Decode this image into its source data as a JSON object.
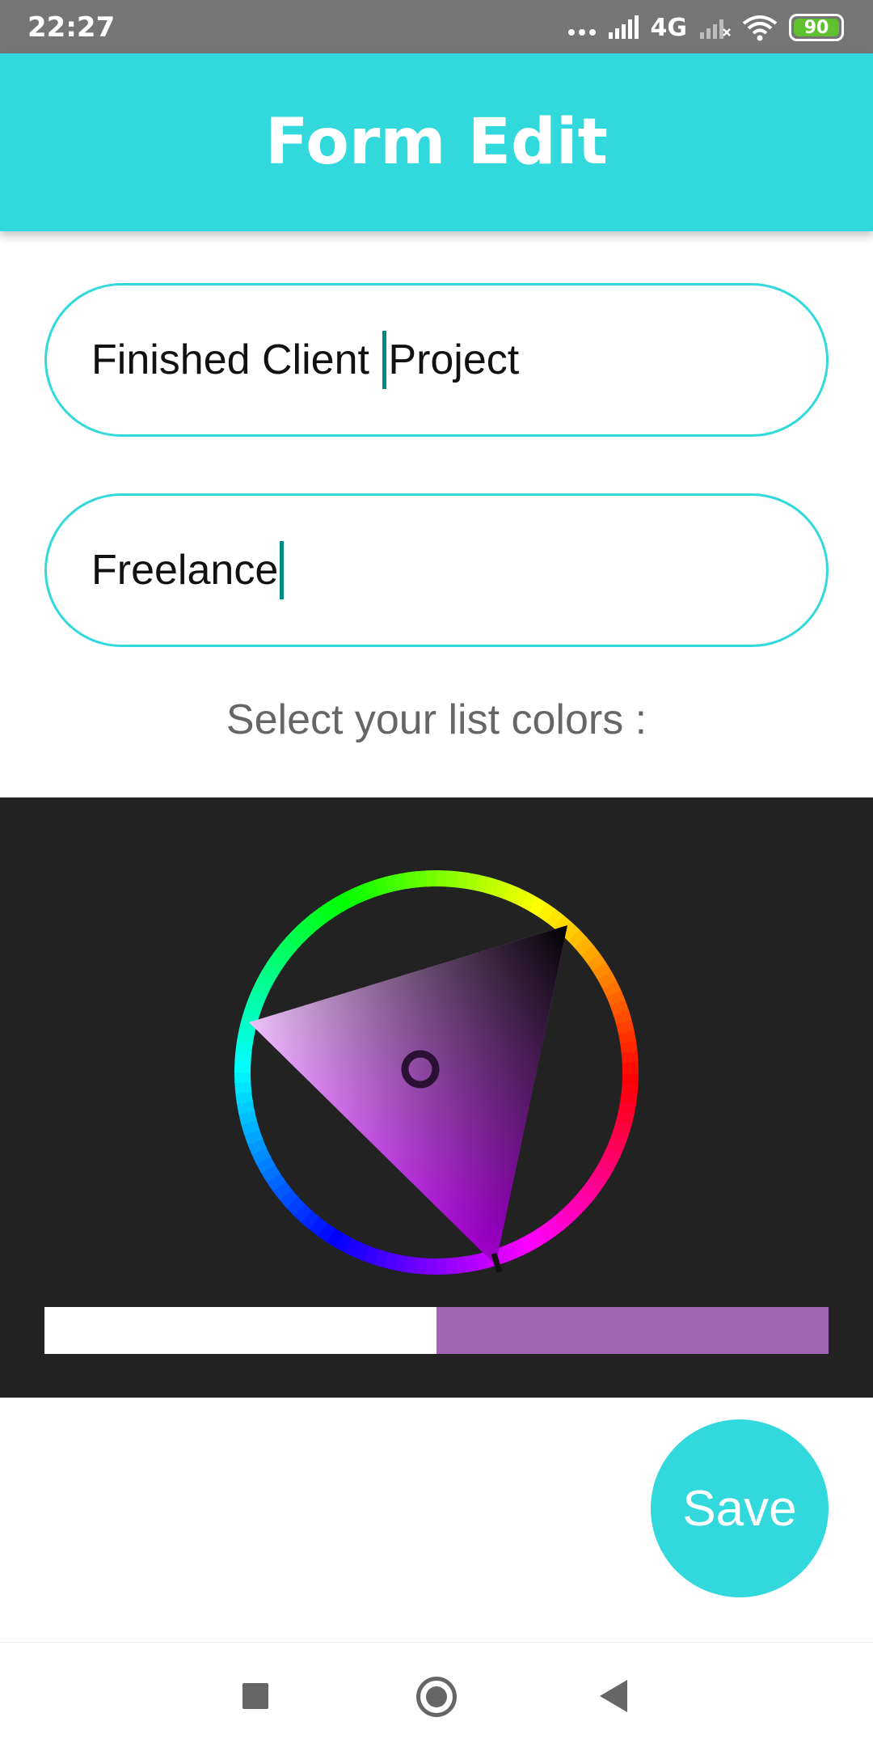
{
  "status_bar": {
    "time": "22:27",
    "network": "4G",
    "battery": "90",
    "icons": [
      "dots-icon",
      "signal-icon",
      "signal-x-icon",
      "wifi-icon",
      "battery-icon"
    ],
    "battery_color": "#5ec12d"
  },
  "app_bar": {
    "title": "Form Edit",
    "color": "#32d9dc"
  },
  "form": {
    "title_field": {
      "value_before_cursor": "Finished Client ",
      "value_after_cursor": "Project"
    },
    "category_field": {
      "value": "Freelance"
    },
    "color_prompt": "Select your list colors :"
  },
  "color_picker": {
    "old_color": "#ffffff",
    "new_color": "#a066b3",
    "hue_color": "#c800ff"
  },
  "actions": {
    "save_label": "Save"
  },
  "nav_bar": {
    "icons": [
      "recents-icon",
      "home-icon",
      "back-icon"
    ]
  }
}
